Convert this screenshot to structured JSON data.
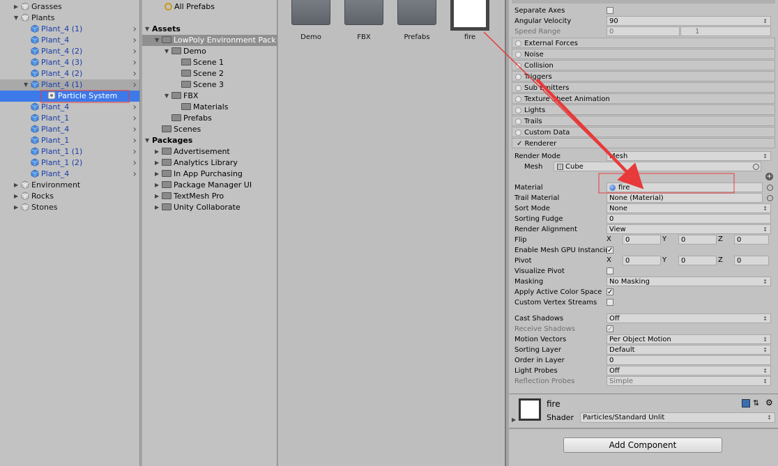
{
  "hierarchy": {
    "items": [
      {
        "label": "Grasses",
        "color": "gray",
        "depth": 1,
        "tri": "▶",
        "chev": false
      },
      {
        "label": "Plants",
        "color": "gray",
        "depth": 1,
        "tri": "▼",
        "chev": false
      },
      {
        "label": "Plant_4 (1)",
        "color": "blue",
        "depth": 2,
        "tri": "",
        "chev": true
      },
      {
        "label": "Plant_4",
        "color": "blue",
        "depth": 2,
        "tri": "",
        "chev": true
      },
      {
        "label": "Plant_4 (2)",
        "color": "blue",
        "depth": 2,
        "tri": "",
        "chev": true
      },
      {
        "label": "Plant_4 (3)",
        "color": "blue",
        "depth": 2,
        "tri": "",
        "chev": true
      },
      {
        "label": "Plant_4 (2)",
        "color": "blue",
        "depth": 2,
        "tri": "",
        "chev": true
      },
      {
        "label": "Plant_4 (1)",
        "color": "blue",
        "depth": 2,
        "tri": "▼",
        "chev": true,
        "highlight": true
      },
      {
        "label": "Particle System",
        "color": "white",
        "depth": 3,
        "tri": "",
        "chev": false,
        "selected": true
      },
      {
        "label": "Plant_4",
        "color": "blue",
        "depth": 2,
        "tri": "",
        "chev": true
      },
      {
        "label": "Plant_1",
        "color": "blue",
        "depth": 2,
        "tri": "",
        "chev": true
      },
      {
        "label": "Plant_4",
        "color": "blue",
        "depth": 2,
        "tri": "",
        "chev": true
      },
      {
        "label": "Plant_1",
        "color": "blue",
        "depth": 2,
        "tri": "",
        "chev": true
      },
      {
        "label": "Plant_1 (1)",
        "color": "blue",
        "depth": 2,
        "tri": "",
        "chev": true
      },
      {
        "label": "Plant_1 (2)",
        "color": "blue",
        "depth": 2,
        "tri": "",
        "chev": true
      },
      {
        "label": "Plant_4",
        "color": "blue",
        "depth": 2,
        "tri": "",
        "chev": true
      },
      {
        "label": "Environment",
        "color": "gray",
        "depth": 1,
        "tri": "▶",
        "chev": false
      },
      {
        "label": "Rocks",
        "color": "gray",
        "depth": 1,
        "tri": "▶",
        "chev": false
      },
      {
        "label": "Stones",
        "color": "gray",
        "depth": 1,
        "tri": "▶",
        "chev": false
      }
    ]
  },
  "project": {
    "all_prefabs": "All Prefabs",
    "tree": [
      {
        "label": "Assets",
        "bold": true,
        "depth": 0,
        "tri": "▼",
        "folder": false
      },
      {
        "label": "LowPoly Environment Pack",
        "depth": 1,
        "tri": "▼",
        "folder": true,
        "selected": true
      },
      {
        "label": "Demo",
        "depth": 2,
        "tri": "▼",
        "folder": true
      },
      {
        "label": "Scene 1",
        "depth": 3,
        "tri": "",
        "folder": true
      },
      {
        "label": "Scene 2",
        "depth": 3,
        "tri": "",
        "folder": true
      },
      {
        "label": "Scene 3",
        "depth": 3,
        "tri": "",
        "folder": true
      },
      {
        "label": "FBX",
        "depth": 2,
        "tri": "▼",
        "folder": true
      },
      {
        "label": "Materials",
        "depth": 3,
        "tri": "",
        "folder": true
      },
      {
        "label": "Prefabs",
        "depth": 2,
        "tri": "",
        "folder": true
      },
      {
        "label": "Scenes",
        "depth": 1,
        "tri": "",
        "folder": true
      },
      {
        "label": "Packages",
        "bold": true,
        "depth": 0,
        "tri": "▼",
        "folder": false
      },
      {
        "label": "Advertisement",
        "depth": 1,
        "tri": "▶",
        "folder": true
      },
      {
        "label": "Analytics Library",
        "depth": 1,
        "tri": "▶",
        "folder": true
      },
      {
        "label": "In App Purchasing",
        "depth": 1,
        "tri": "▶",
        "folder": true
      },
      {
        "label": "Package Manager UI",
        "depth": 1,
        "tri": "▶",
        "folder": true
      },
      {
        "label": "TextMesh Pro",
        "depth": 1,
        "tri": "▶",
        "folder": true
      },
      {
        "label": "Unity Collaborate",
        "depth": 1,
        "tri": "▶",
        "folder": true
      }
    ]
  },
  "assets": {
    "items": [
      {
        "label": "Demo"
      },
      {
        "label": "FBX"
      },
      {
        "label": "Prefabs"
      },
      {
        "label": "fire",
        "material": true
      }
    ]
  },
  "inspector": {
    "velocity": {
      "separate_axes": "Separate Axes",
      "angular_velocity": "Angular Velocity",
      "angular_value": "90",
      "speed_range": "Speed Range",
      "speed_min": "0",
      "speed_max": "1"
    },
    "modules": [
      "External Forces",
      "Noise",
      "Collision",
      "Triggers",
      "Sub Emitters",
      "Texture Sheet Animation",
      "Lights",
      "Trails",
      "Custom Data"
    ],
    "renderer_header": "✓ Renderer",
    "render_mode": {
      "label": "Render Mode",
      "value": "Mesh"
    },
    "mesh": {
      "label": "Mesh",
      "value": "Cube"
    },
    "props": [
      {
        "label": "Material",
        "value": "fire",
        "kind": "obj"
      },
      {
        "label": "Trail Material",
        "value": "None (Material)",
        "kind": "obj"
      },
      {
        "label": "Sort Mode",
        "value": "None",
        "kind": "dd"
      },
      {
        "label": "Sorting Fudge",
        "value": "0",
        "kind": "text"
      },
      {
        "label": "Render Alignment",
        "value": "View",
        "kind": "dd"
      },
      {
        "label": "Flip",
        "kind": "xyz",
        "x": "0",
        "y": "0",
        "z": "0"
      },
      {
        "label": "Enable Mesh GPU Instancing",
        "kind": "check",
        "checked": true
      },
      {
        "label": "Pivot",
        "kind": "xyz",
        "x": "0",
        "y": "0",
        "z": "0"
      },
      {
        "label": "Visualize Pivot",
        "kind": "check",
        "checked": false
      },
      {
        "label": "Masking",
        "value": "No Masking",
        "kind": "dd"
      },
      {
        "label": "Apply Active Color Space",
        "kind": "check",
        "checked": true
      },
      {
        "label": "Custom Vertex Streams",
        "kind": "check",
        "checked": false
      }
    ],
    "props2": [
      {
        "label": "Cast Shadows",
        "value": "Off",
        "kind": "dd"
      },
      {
        "label": "Receive Shadows",
        "kind": "check",
        "checked": true,
        "dim": true
      },
      {
        "label": "Motion Vectors",
        "value": "Per Object Motion",
        "kind": "dd"
      },
      {
        "label": "Sorting Layer",
        "value": "Default",
        "kind": "dd"
      },
      {
        "label": "Order in Layer",
        "value": "0",
        "kind": "text"
      },
      {
        "label": "Light Probes",
        "value": "Off",
        "kind": "dd"
      },
      {
        "label": "Reflection Probes",
        "value": "Simple",
        "kind": "dd",
        "dim": true
      }
    ],
    "axis": {
      "x": "X",
      "y": "Y",
      "z": "Z"
    },
    "material_panel": {
      "name": "fire",
      "shader_label": "Shader",
      "shader_value": "Particles/Standard Unlit"
    },
    "add_component": "Add Component"
  },
  "colors": {
    "selection": "#3d79e8",
    "annotation": "#e83a3a"
  }
}
